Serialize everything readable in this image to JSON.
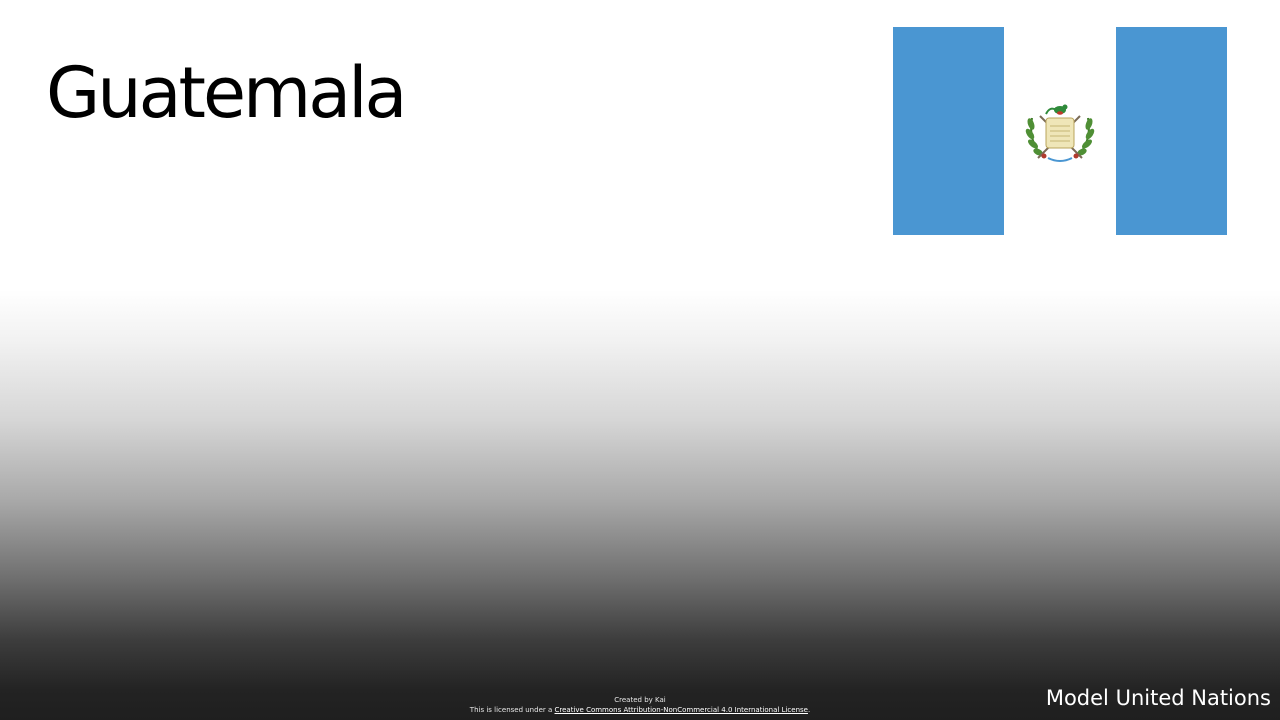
{
  "slide": {
    "title": "Guatemala"
  },
  "flag": {
    "country": "Guatemala",
    "band_color": "#4a96d2",
    "center_color": "#ffffff",
    "emblem_icon": "coat-of-arms-icon"
  },
  "footer": {
    "credit_line": "Created by Kai",
    "license_prefix": "This is licensed under a ",
    "license_link": "Creative Commons Attribution-NonCommercial 4.0 International License",
    "license_suffix": ".",
    "brand": "Model United Nations"
  },
  "colors": {
    "background_top": "#ffffff",
    "background_bottom": "#1f1f1f",
    "title_text": "#000000",
    "footer_text": "#ffffff"
  }
}
